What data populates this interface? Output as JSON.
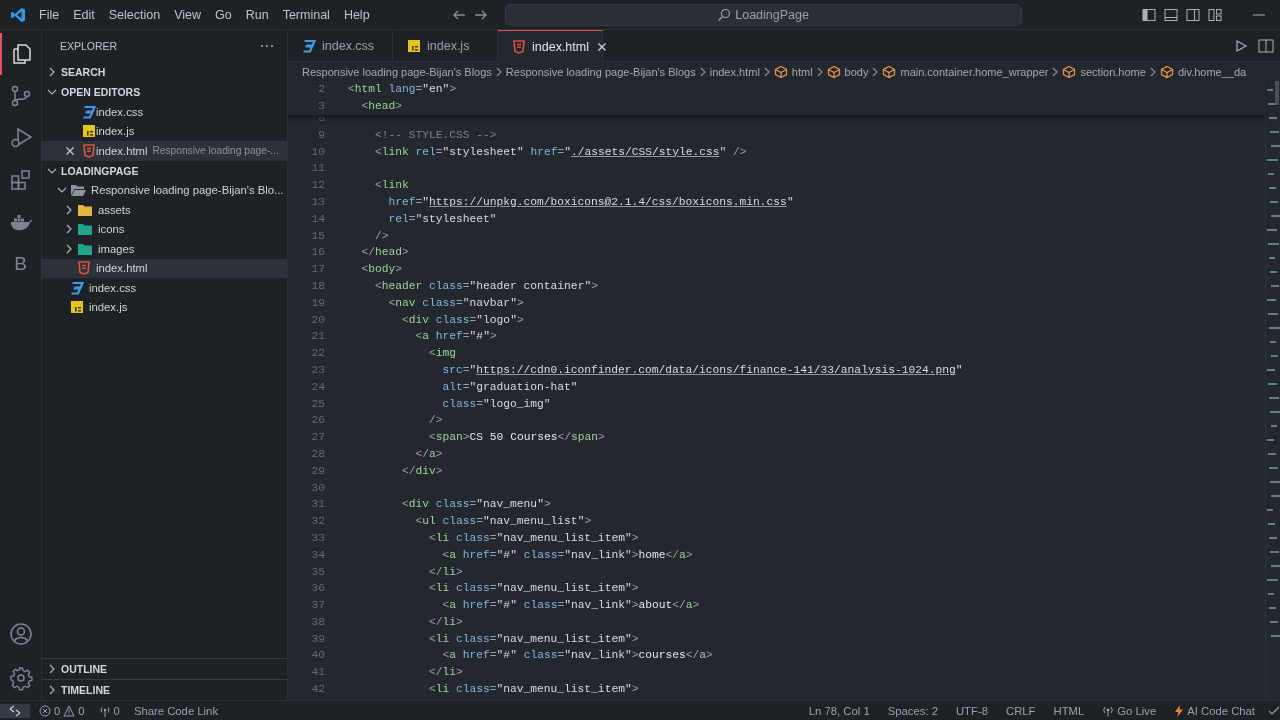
{
  "menu": [
    "File",
    "Edit",
    "Selection",
    "View",
    "Go",
    "Run",
    "Terminal",
    "Help"
  ],
  "command_center": {
    "text": "LoadingPage"
  },
  "activity_bar": [
    {
      "kind": "explorer",
      "selected": true
    },
    {
      "kind": "source-control",
      "selected": false
    },
    {
      "kind": "run",
      "selected": false
    },
    {
      "kind": "extensions",
      "selected": false
    },
    {
      "kind": "docker",
      "selected": false
    },
    {
      "kind": "letter",
      "label": "B",
      "selected": false
    }
  ],
  "activity_bar_bottom": [
    {
      "kind": "account"
    },
    {
      "kind": "settings"
    }
  ],
  "sidebar": {
    "title": "EXPLORER",
    "sections": [
      {
        "kind": "header",
        "title": "SEARCH",
        "expanded": false
      },
      {
        "kind": "open-editors",
        "title": "OPEN EDITORS",
        "expanded": true,
        "items": [
          {
            "name": "index.css",
            "kind": "css",
            "selected": false
          },
          {
            "name": "index.js",
            "kind": "js",
            "selected": false
          },
          {
            "name": "index.html",
            "kind": "html",
            "description": "Responsive loading page-...",
            "selected": true
          }
        ]
      },
      {
        "kind": "tree",
        "title": "LOADINGPAGE",
        "expanded": true,
        "items": [
          {
            "name": "Responsive loading page-Bijan's Blo...",
            "kind": "folder",
            "color": "#8c969e",
            "expanded": true,
            "selected": false,
            "children": [
              {
                "name": "assets",
                "kind": "folder",
                "color": "#e2b53e",
                "expanded": false,
                "selected": false
              },
              {
                "name": "icons",
                "kind": "folder",
                "color": "#1fa58a",
                "expanded": false,
                "selected": false
              },
              {
                "name": "images",
                "kind": "folder",
                "color": "#1fa58a",
                "expanded": false,
                "selected": false
              },
              {
                "name": "index.html",
                "kind": "html",
                "selected": true
              }
            ]
          },
          {
            "name": "index.css",
            "kind": "css",
            "selected": false
          },
          {
            "name": "index.js",
            "kind": "js",
            "selected": false
          }
        ]
      }
    ],
    "bottom_sections": [
      {
        "title": "OUTLINE",
        "expanded": false
      },
      {
        "title": "TIMELINE",
        "expanded": false
      }
    ]
  },
  "tabs": [
    {
      "label": "index.css",
      "kind": "css",
      "selected": false
    },
    {
      "label": "index.js",
      "kind": "js",
      "selected": false
    },
    {
      "label": "index.html",
      "kind": "html",
      "selected": true
    }
  ],
  "breadcrumbs": [
    {
      "label": "Responsive loading page-Bijan's Blogs",
      "kind": "folder"
    },
    {
      "label": "Responsive loading page-Bijan's Blogs",
      "kind": "folder"
    },
    {
      "label": "index.html",
      "kind": "html"
    },
    {
      "label": "html",
      "kind": "symbol"
    },
    {
      "label": "body",
      "kind": "symbol"
    },
    {
      "label": "main.container.home_wrapper",
      "kind": "symbol"
    },
    {
      "label": "section.home",
      "kind": "symbol"
    },
    {
      "label": "div.home__da",
      "kind": "symbol"
    }
  ],
  "sticky_lines": [
    {
      "number": "2",
      "text": "<html lang=\"en\">"
    },
    {
      "number": "3",
      "text": "  <head>"
    }
  ],
  "code_lines": [
    {
      "number": "8"
    },
    {
      "number": "9",
      "text": "    <!-- STYLE.CSS -->"
    },
    {
      "number": "10",
      "text": "    <link rel=\"stylesheet\" href=\"./assets/CSS/style.css\" />"
    },
    {
      "number": "11"
    },
    {
      "number": "12",
      "text": "    <link"
    },
    {
      "number": "13",
      "text": "      href=\"https://unpkg.com/boxicons@2.1.4/css/boxicons.min.css\""
    },
    {
      "number": "14",
      "text": "      rel=\"stylesheet\""
    },
    {
      "number": "15",
      "text": "    />"
    },
    {
      "number": "16",
      "text": "  </head>"
    },
    {
      "number": "17",
      "text": "  <body>"
    },
    {
      "number": "18",
      "text": "    <header class=\"header container\">"
    },
    {
      "number": "19",
      "text": "      <nav class=\"navbar\">"
    },
    {
      "number": "20",
      "text": "        <div class=\"logo\">"
    },
    {
      "number": "21",
      "text": "          <a href=\"#\">"
    },
    {
      "number": "22",
      "text": "            <img"
    },
    {
      "number": "23",
      "text": "              src=\"https://cdn0.iconfinder.com/data/icons/finance-141/33/analysis-1024.png\""
    },
    {
      "number": "24",
      "text": "              alt=\"graduation-hat\""
    },
    {
      "number": "25",
      "text": "              class=\"logo_img\""
    },
    {
      "number": "26",
      "text": "            />"
    },
    {
      "number": "27",
      "text": "            <span>CS 50 Courses</span>"
    },
    {
      "number": "28",
      "text": "          </a>"
    },
    {
      "number": "29",
      "text": "        </div>"
    },
    {
      "number": "30"
    },
    {
      "number": "31",
      "text": "        <div class=\"nav_menu\">"
    },
    {
      "number": "32",
      "text": "          <ul class=\"nav_menu_list\">"
    },
    {
      "number": "33",
      "text": "            <li class=\"nav_menu_list_item\">"
    },
    {
      "number": "34",
      "text": "              <a href=\"#\" class=\"nav_link\">home</a>"
    },
    {
      "number": "35",
      "text": "            </li>"
    },
    {
      "number": "36",
      "text": "            <li class=\"nav_menu_list_item\">"
    },
    {
      "number": "37",
      "text": "              <a href=\"#\" class=\"nav_link\">about</a>"
    },
    {
      "number": "38",
      "text": "            </li>"
    },
    {
      "number": "39",
      "text": "            <li class=\"nav_menu_list_item\">"
    },
    {
      "number": "40",
      "text": "              <a href=\"#\" class=\"nav_link\">courses</a>"
    },
    {
      "number": "41",
      "text": "            </li>"
    },
    {
      "number": "42",
      "text": "            <li class=\"nav_menu_list_item\">"
    }
  ],
  "status_bar": {
    "left": [
      {
        "kind": "remote"
      },
      {
        "kind": "problems",
        "errors": "0",
        "warnings": "0"
      },
      {
        "kind": "ports",
        "text": "0"
      },
      {
        "kind": "text",
        "text": "Share Code Link"
      }
    ],
    "right": [
      {
        "kind": "text",
        "text": "Ln 78, Col 1"
      },
      {
        "kind": "text",
        "text": "Spaces: 2"
      },
      {
        "kind": "text",
        "text": "UTF-8"
      },
      {
        "kind": "text",
        "text": "CRLF"
      },
      {
        "kind": "text",
        "text": "HTML"
      },
      {
        "kind": "go-live",
        "text": "Go Live"
      },
      {
        "kind": "ai-chat",
        "text": "AI Code Chat"
      },
      {
        "kind": "check"
      }
    ]
  }
}
